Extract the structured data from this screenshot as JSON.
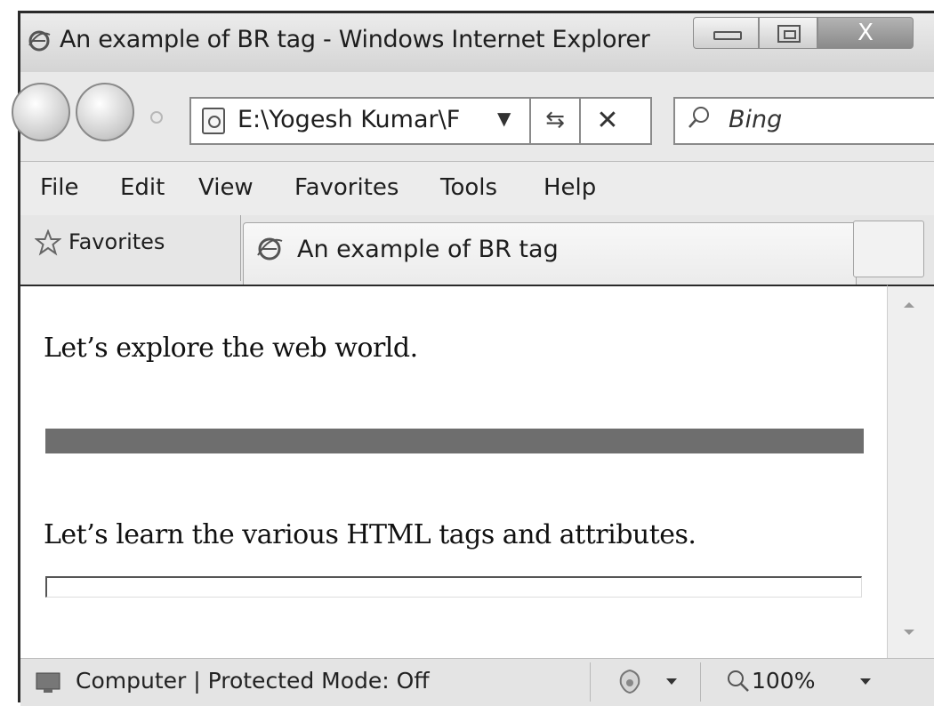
{
  "window": {
    "title": "An example of BR tag - Windows Internet Explorer",
    "close_label": "X"
  },
  "toolbar": {
    "address": "E:\\Yogesh Kumar\\F",
    "search_placeholder": "Bing",
    "refresh_glyph": "⇆",
    "stop_glyph": "✕"
  },
  "menu": {
    "items": [
      "File",
      "Edit",
      "View",
      "Favorites",
      "Tools",
      "Help"
    ]
  },
  "tabs": {
    "favorites_label": "Favorites",
    "active_tab_label": "An example of BR tag"
  },
  "content": {
    "paragraph1": "Let’s explore the web world.",
    "paragraph2": "Let’s learn the various HTML tags and attributes."
  },
  "statusbar": {
    "zone_text": "Computer | Protected Mode: Off",
    "zoom": "100%"
  },
  "colors": {
    "hr_thick": "#6e6e6e",
    "chrome": "#e9e9e9"
  }
}
